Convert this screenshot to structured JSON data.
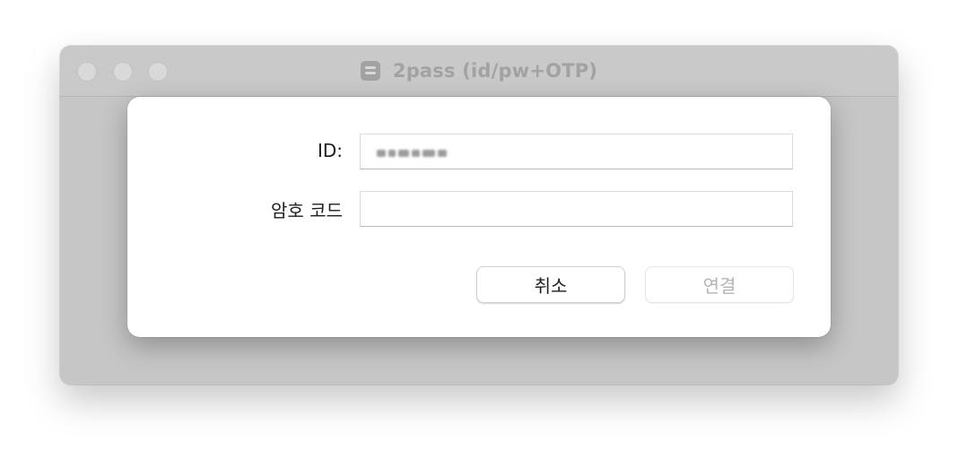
{
  "window": {
    "title": "2pass (id/pw+OTP)",
    "app_icon": "2pass-app-icon",
    "traffic_lights": [
      "close",
      "minimize",
      "zoom"
    ]
  },
  "dialog": {
    "id_label": "ID:",
    "id_value": "(blurred)",
    "code_label": "암호 코드",
    "code_value": "",
    "cancel_label": "취소",
    "connect_label": "연결",
    "connect_enabled": false
  },
  "colors": {
    "window_dimmed": "#c6c6c6",
    "sheet_background": "#ffffff",
    "disabled_text": "#b4b4b4"
  }
}
